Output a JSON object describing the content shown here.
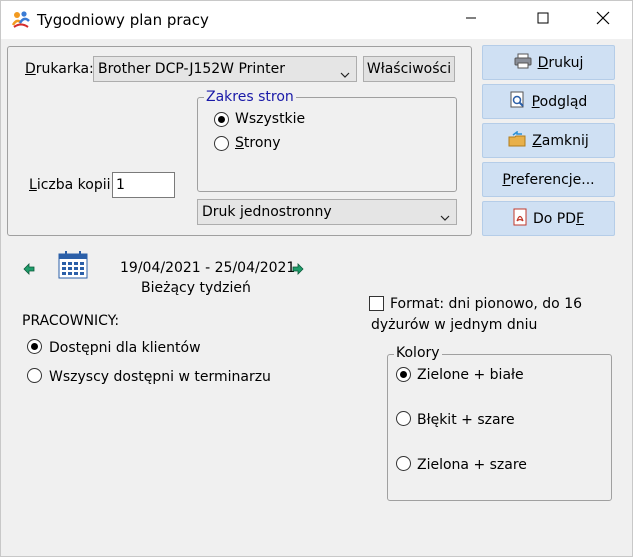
{
  "window": {
    "title": "Tygodniowy plan pracy",
    "icons": {
      "app": "app-people-icon",
      "minimize": "minimize-icon",
      "maximize": "maximize-icon",
      "close": "close-icon"
    }
  },
  "printer": {
    "label_pre": "D",
    "label_rest": "rukarka:",
    "selected": "Brother DCP-J152W Printer",
    "properties_button": "Właściwości",
    "copies_label_pre": "L",
    "copies_label_rest": "iczba kopii:",
    "copies_value": "1",
    "duplex_selected": "Druk jednostronny"
  },
  "page_range": {
    "legend": "Zakres stron",
    "options": [
      {
        "label": "Wszystkie",
        "selected": true
      },
      {
        "label_pre": "",
        "label_u": "S",
        "label_rest": "trony",
        "selected": false
      }
    ]
  },
  "side_buttons": [
    {
      "name": "print-button",
      "icon": "printer-icon",
      "pre": "",
      "u": "D",
      "rest": "rukuj"
    },
    {
      "name": "preview-button",
      "icon": "preview-icon",
      "pre": "",
      "u": "P",
      "rest": "odgląd"
    },
    {
      "name": "close-button",
      "icon": "folder-close-icon",
      "pre": "",
      "u": "Z",
      "rest": "amknij"
    },
    {
      "name": "preferences-button",
      "icon": "",
      "pre": "",
      "u": "P",
      "rest": "referencje..."
    },
    {
      "name": "pdf-button",
      "icon": "pdf-icon",
      "pre": "Do PD",
      "u": "F",
      "rest": ""
    }
  ],
  "period": {
    "range": "19/04/2021 - 25/04/2021",
    "caption": "Bieżący tydzień",
    "icons": {
      "prev": "arrow-left-icon",
      "next": "arrow-right-icon",
      "calendar": "calendar-icon"
    }
  },
  "employees": {
    "heading": "PRACOWNICY:",
    "options": [
      {
        "label": "Dostępni dla klientów",
        "selected": true
      },
      {
        "label": "Wszyscy dostępni w terminarzu",
        "selected": false
      }
    ]
  },
  "format": {
    "checked": false,
    "line1": "Format: dni pionowo, do 16",
    "line2": "dyżurów w jednym dniu"
  },
  "colors": {
    "legend": "Kolory",
    "options": [
      {
        "label": "Zielone + białe",
        "selected": true
      },
      {
        "label": "Błękit + szare",
        "selected": false
      },
      {
        "label": "Zielona + szare",
        "selected": false
      }
    ]
  }
}
